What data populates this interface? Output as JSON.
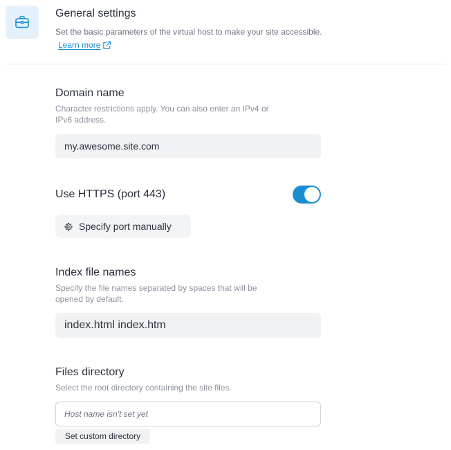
{
  "header": {
    "icon": "briefcase-icon",
    "title": "General settings",
    "description": "Set the basic parameters of the virtual host to make your site accessible.",
    "learn_more": "Learn more"
  },
  "domain": {
    "title": "Domain name",
    "hint": "Character restrictions apply. You can also enter an IPv4 or IPv6 address.",
    "value": "my.awesome.site.com"
  },
  "https": {
    "title": "Use HTTPS (port 443)",
    "enabled": true,
    "port_button": "Specify port manually"
  },
  "index_files": {
    "title": "Index file names",
    "hint": "Specify the file names separated by spaces that will be opened by default.",
    "value": "index.html index.htm"
  },
  "files_directory": {
    "title": "Files directory",
    "hint": "Select the root directory containing the site files.",
    "placeholder": "Host name isn't set yet",
    "custom_button": "Set custom directory"
  },
  "colors": {
    "accent": "#1a8dd0",
    "icon_box": "#e4f1fb"
  }
}
